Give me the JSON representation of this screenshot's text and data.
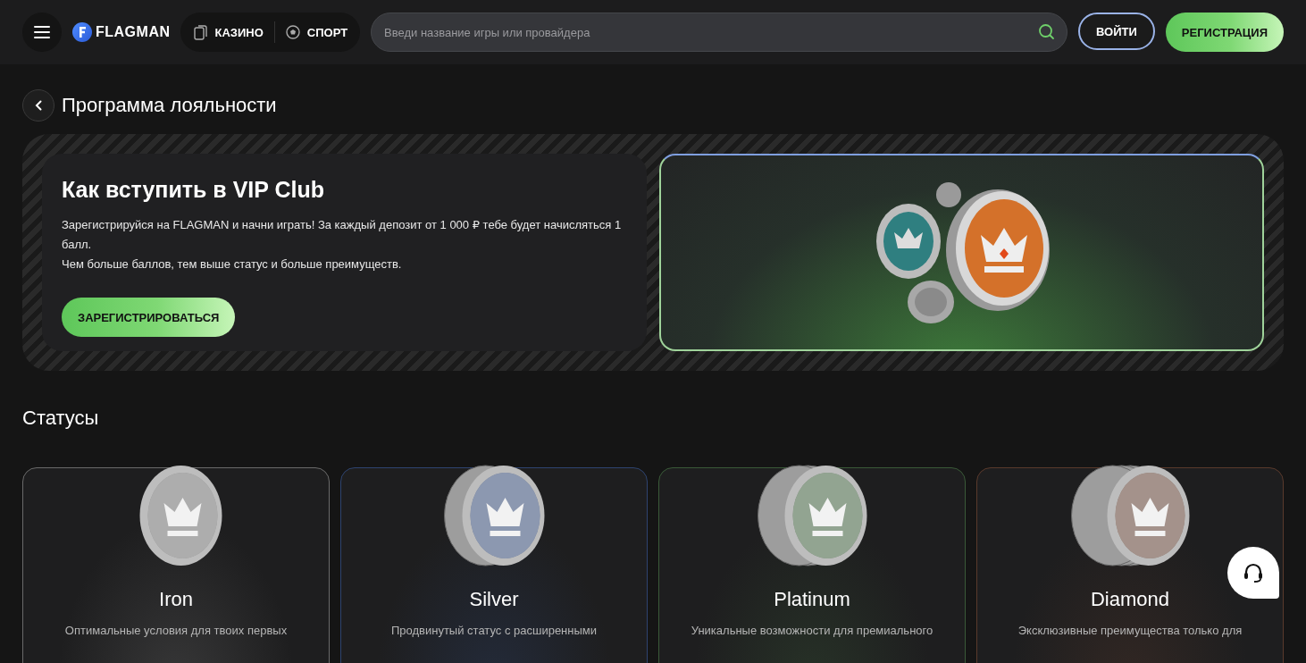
{
  "header": {
    "logo": "FLAGMAN",
    "nav": [
      {
        "label": "КАЗИНО",
        "kind": "cards",
        "selected": false
      },
      {
        "label": "СПОРТ",
        "kind": "ball",
        "selected": false
      }
    ],
    "search": {
      "placeholder": "Введи название игры или провайдера"
    },
    "login": "ВОЙТИ",
    "register": "РЕГИСТРАЦИЯ"
  },
  "page_title": "Программа лояльности",
  "hero": {
    "title": "Как вступить в VIP Club",
    "paragraphs": [
      "Зарегистрируйся на FLAGMAN и начни играть! За каждый депозит от 1 000 ₽ тебе будет начисляться 1 балл.",
      "Чем больше баллов, тем выше статус и больше преимуществ."
    ],
    "button": "ЗАРЕГИСТРИРОВАТЬСЯ"
  },
  "statuses": {
    "title": "Статусы",
    "items": [
      {
        "name": "Iron",
        "description": "Оптимальные условия для твоих первых",
        "color": "#6a6a6a"
      },
      {
        "name": "Silver",
        "description": "Продвинутый статус с расширенными",
        "color": "#2e4470"
      },
      {
        "name": "Platinum",
        "description": "Уникальные возможности для премиального",
        "color": "#3a5a38"
      },
      {
        "name": "Diamond",
        "description": "Эксклюзивные преимущества только для",
        "color": "#5a3a2c"
      }
    ]
  }
}
